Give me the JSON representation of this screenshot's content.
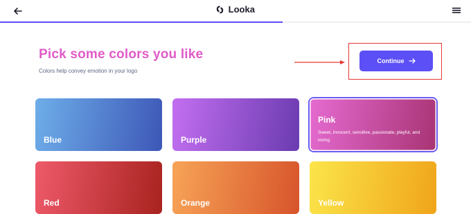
{
  "header": {
    "logo_text": "Looka",
    "progress_fraction": 0.6
  },
  "page": {
    "title": "Pick some colors you like",
    "subtitle": "Colors help convey emotion in your logo"
  },
  "continue_button": {
    "label": "Continue"
  },
  "colors": [
    {
      "label": "Blue",
      "gradient": [
        "#6eaee9",
        "#3d57b7"
      ],
      "selected": false
    },
    {
      "label": "Purple",
      "gradient": [
        "#c26ff0",
        "#6b3bb0"
      ],
      "selected": false
    },
    {
      "label": "Pink",
      "gradient": [
        "#e56bd1",
        "#a83474"
      ],
      "selected": true,
      "description": "Sweet, innocent, sensitive, passionate, playful, and loving"
    },
    {
      "label": "Red",
      "gradient": [
        "#ee5a6a",
        "#a8231f"
      ],
      "selected": false
    },
    {
      "label": "Orange",
      "gradient": [
        "#f7a457",
        "#d7542b"
      ],
      "selected": false
    },
    {
      "label": "Yellow",
      "gradient": [
        "#fbe54a",
        "#f0a41a"
      ],
      "selected": false
    }
  ],
  "theme": {
    "accent": "#5b4ff5",
    "title_color": "#e15bc8",
    "annotation_color": "#e53935"
  }
}
